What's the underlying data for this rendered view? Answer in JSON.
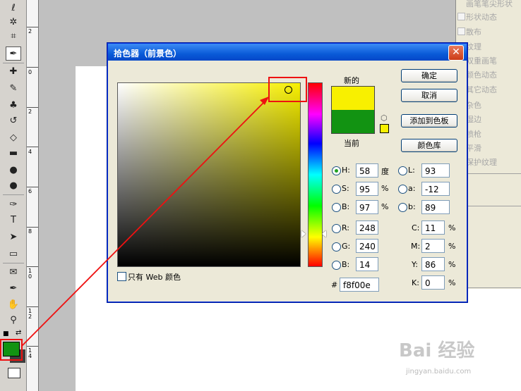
{
  "dialog": {
    "title": "拾色器（前景色）",
    "close_glyph": "✕",
    "new_label": "新的",
    "current_label": "当前",
    "web_only_label": "只有 Web 颜色",
    "buttons": {
      "ok": "确定",
      "cancel": "取消",
      "add_to_swatches": "添加到色板",
      "color_libraries": "颜色库"
    },
    "hsb": {
      "h_label": "H:",
      "h_value": "58",
      "h_unit": "度",
      "s_label": "S:",
      "s_value": "95",
      "s_unit": "%",
      "b_label": "B:",
      "b_value": "97",
      "b_unit": "%"
    },
    "lab": {
      "l_label": "L:",
      "l_value": "93",
      "a_label": "a:",
      "a_value": "-12",
      "b_label": "b:",
      "b_value": "89"
    },
    "rgb": {
      "r_label": "R:",
      "r_value": "248",
      "g_label": "G:",
      "g_value": "240",
      "b_label": "B:",
      "b_value": "14"
    },
    "cmyk": {
      "c_label": "C:",
      "c_value": "11",
      "m_label": "M:",
      "m_value": "2",
      "y_label": "Y:",
      "y_value": "86",
      "k_label": "K:",
      "k_value": "0",
      "unit": "%"
    },
    "hex_label": "#",
    "hex_value": "f8f00e",
    "new_color": "#f8f000",
    "current_color": "#129312"
  },
  "right_panel": {
    "items": [
      "画笔笔尖形状",
      "形状动态",
      "散布",
      "纹理",
      "双重画笔",
      "颜色动态",
      "其它动态",
      "杂色",
      "湿边",
      "喷枪",
      "平滑",
      "保护纹理"
    ]
  },
  "ruler": {
    "labels": [
      "2",
      "0",
      "2",
      "4",
      "6",
      "8",
      "1\n0",
      "1\n2",
      "1\n4"
    ]
  },
  "toolbox": {
    "tools": [
      "lasso-icon",
      "magic-wand-icon",
      "crop-icon",
      "eyedropper-icon",
      "healing-brush-icon",
      "brush-icon",
      "clone-stamp-icon",
      "history-brush-icon",
      "eraser-icon",
      "gradient-icon",
      "blur-icon",
      "dodge-icon",
      "pen-icon",
      "type-icon",
      "path-select-icon",
      "shape-icon",
      "notes-icon",
      "hand-icon",
      "zoom-icon"
    ],
    "foreground_color": "#129312",
    "background_color": "#3d3d3d"
  },
  "watermark": {
    "brand": "Bai 经验",
    "url": "jingyan.baidu.com"
  },
  "colors": {
    "accent_red": "#ee1111",
    "title_blue": "#0a5bd8"
  }
}
